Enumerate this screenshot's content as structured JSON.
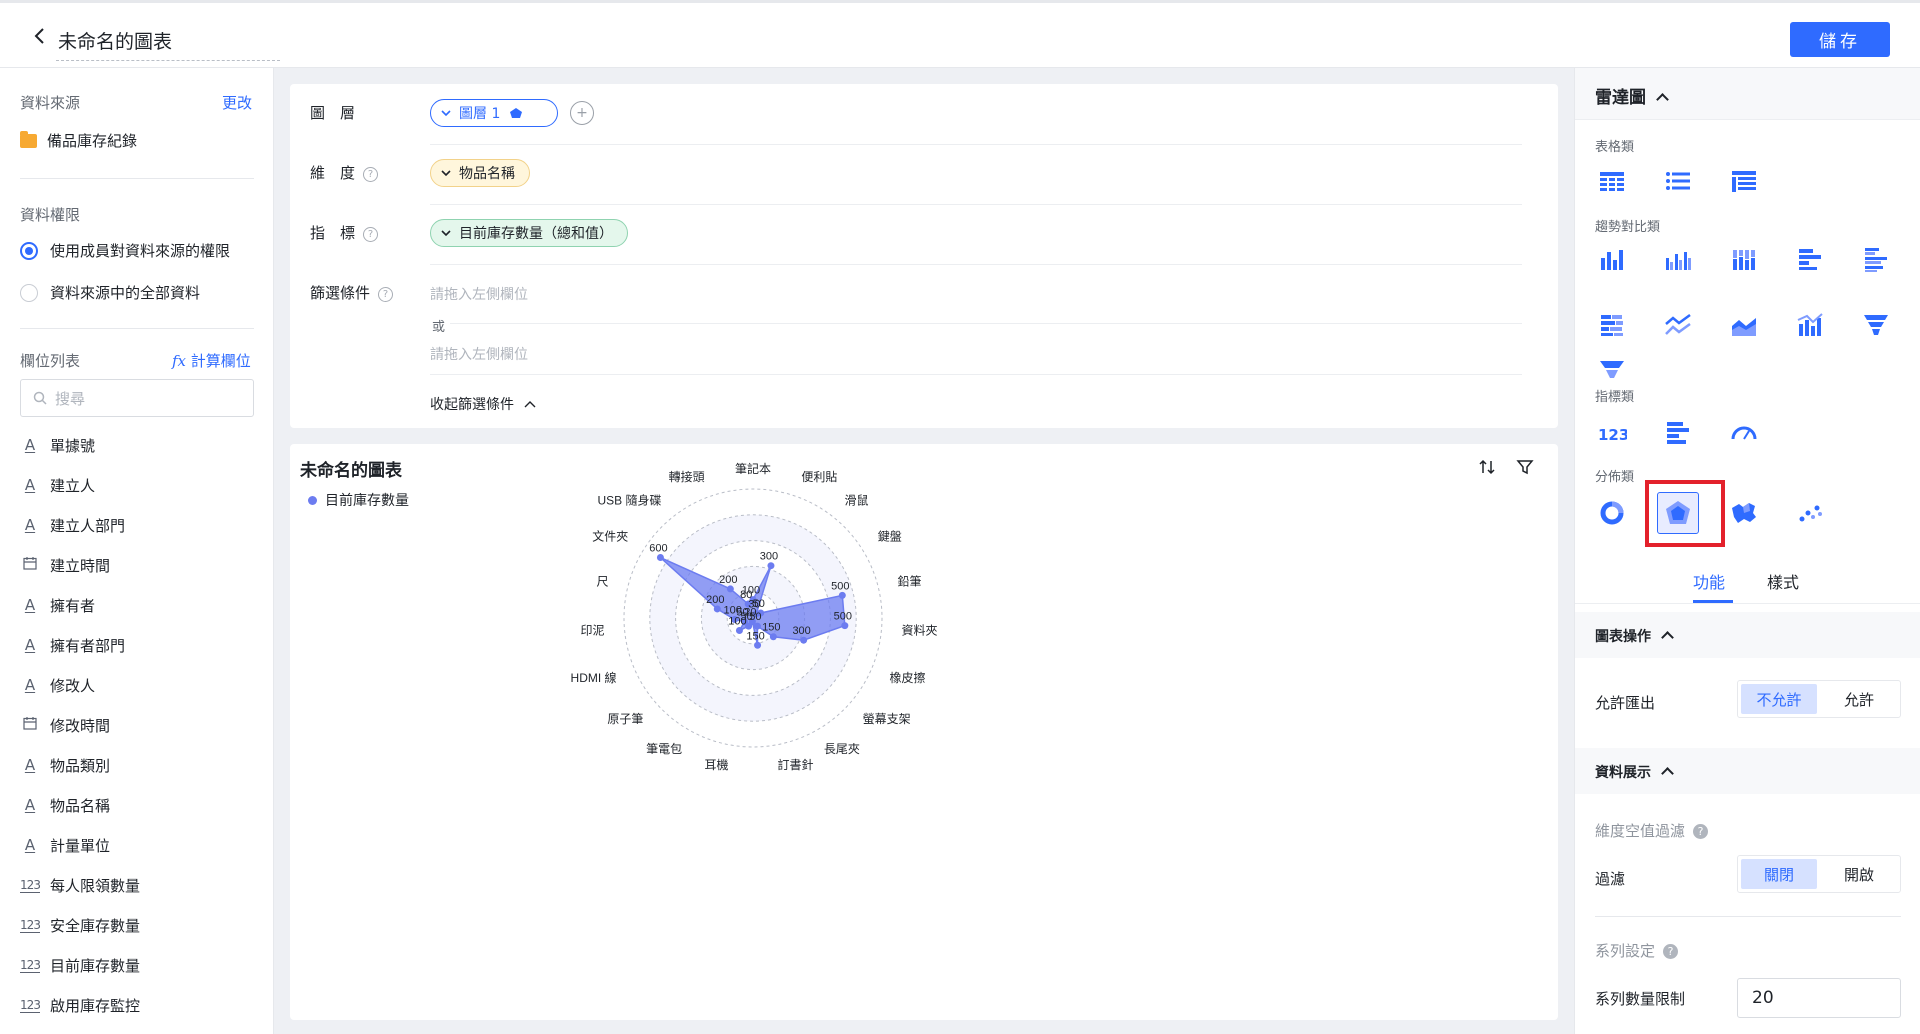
{
  "header": {
    "title": "未命名的圖表",
    "save_label": "儲存"
  },
  "left": {
    "datasource_label": "資料來源",
    "change_link": "更改",
    "datasource_name": "備品庫存紀錄",
    "permission_label": "資料權限",
    "permission_options": [
      "使用成員對資料來源的權限",
      "資料來源中的全部資料"
    ],
    "fields_label": "欄位列表",
    "calc_field_link": "計算欄位",
    "search_placeholder": "搜尋",
    "fields": [
      {
        "name": "單據號",
        "type": "text"
      },
      {
        "name": "建立人",
        "type": "text"
      },
      {
        "name": "建立人部門",
        "type": "text"
      },
      {
        "name": "建立時間",
        "type": "date"
      },
      {
        "name": "擁有者",
        "type": "text"
      },
      {
        "name": "擁有者部門",
        "type": "text"
      },
      {
        "name": "修改人",
        "type": "text"
      },
      {
        "name": "修改時間",
        "type": "date"
      },
      {
        "name": "物品類別",
        "type": "text"
      },
      {
        "name": "物品名稱",
        "type": "text"
      },
      {
        "name": "計量單位",
        "type": "text"
      },
      {
        "name": "每人限領數量",
        "type": "number"
      },
      {
        "name": "安全庫存數量",
        "type": "number"
      },
      {
        "name": "目前庫存數量",
        "type": "number"
      },
      {
        "name": "啟用庫存監控",
        "type": "number"
      }
    ]
  },
  "config": {
    "layer_label": "圖　層",
    "layer_pill": "圖層 1",
    "dimension_label": "維　度",
    "dimension_pill": "物品名稱",
    "metric_label": "指　標",
    "metric_pill": "目前庫存數量（總和值）",
    "filter_label": "篩選條件",
    "filter_placeholder": "請拖入左側欄位",
    "or_label": "或",
    "collapse_label": "收起篩選條件"
  },
  "chart_card": {
    "title": "未命名的圖表",
    "legend": "目前庫存數量"
  },
  "chart_data": {
    "type": "radar",
    "categories": [
      "筆記本",
      "便利貼",
      "滑鼠",
      "鍵盤",
      "鉛筆",
      "資料夾",
      "橡皮擦",
      "螢幕支架",
      "長尾夾",
      "訂書針",
      "耳機",
      "筆電包",
      "原子筆",
      "HDMI 線",
      "印泥",
      "尺",
      "文件夾",
      "USB 隨身碟",
      "轉接頭"
    ],
    "series": [
      {
        "name": "目前庫存數量",
        "values": [
          100,
          300,
          30,
          50,
          500,
          500,
          300,
          150,
          50,
          150,
          20,
          50,
          100,
          50,
          100,
          200,
          600,
          200,
          80
        ]
      }
    ],
    "ring_max": 700,
    "color": "#6c7cf0"
  },
  "right": {
    "chart_type_title": "雷達圖",
    "categories": [
      "表格類",
      "趨勢對比類",
      "指標類",
      "分佈類"
    ],
    "tabs": [
      "功能",
      "樣式"
    ],
    "group_chart_ops": "圖表操作",
    "allow_export_label": "允許匯出",
    "allow_export_options": [
      "不允許",
      "允許"
    ],
    "group_data_display": "資料展示",
    "dim_null_filter_label": "維度空值過濾",
    "filter_label": "過濾",
    "filter_options": [
      "關閉",
      "開啟"
    ],
    "series_settings_label": "系列設定",
    "series_limit_label": "系列數量限制",
    "series_limit_value": "20"
  }
}
